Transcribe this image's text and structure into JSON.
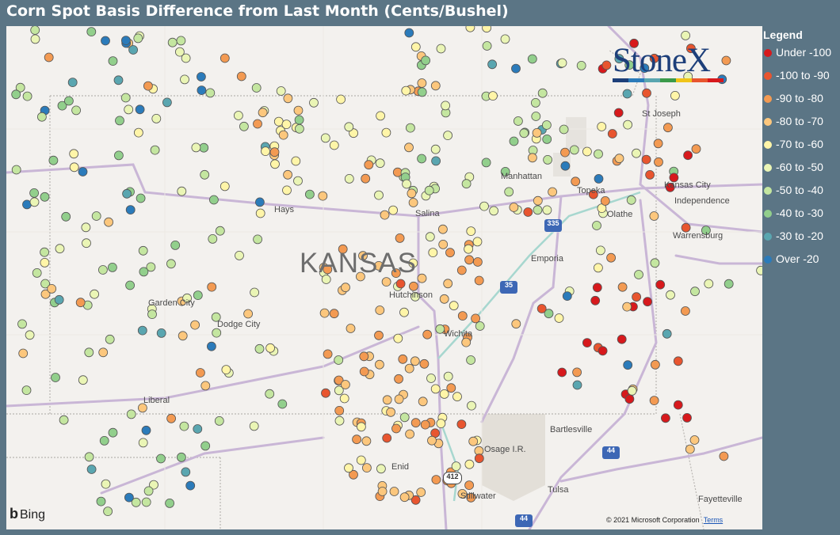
{
  "title": "Corn Spot Basis Difference from Last Month (Cents/Bushel)",
  "legend": {
    "header": "Legend",
    "items": [
      {
        "label": "Under -100",
        "color": "#d7191c"
      },
      {
        "label": "-100 to -90",
        "color": "#e8552f"
      },
      {
        "label": "-90 to -80",
        "color": "#f39a52"
      },
      {
        "label": "-80 to -70",
        "color": "#fcc77d"
      },
      {
        "label": "-70 to -60",
        "color": "#fff5a8"
      },
      {
        "label": "-60 to -50",
        "color": "#eaf5b5"
      },
      {
        "label": "-50 to -40",
        "color": "#c4e6a0"
      },
      {
        "label": "-40 to -30",
        "color": "#92cf8c"
      },
      {
        "label": "-30 to -20",
        "color": "#5aa6b0"
      },
      {
        "label": "Over -20",
        "color": "#2b7bba"
      }
    ]
  },
  "map": {
    "state_label": "KANSAS",
    "cities": [
      "St Joseph",
      "Manhattan",
      "Topeka",
      "Kansas City",
      "Independence",
      "Olathe",
      "Hays",
      "Salina",
      "Warrensburg",
      "Emporia",
      "Garden City",
      "Hutchinson",
      "Dodge City",
      "Wichita",
      "Liberal",
      "Bartlesville",
      "Osage I.R.",
      "Enid",
      "Tulsa",
      "Stillwater",
      "Fayetteville"
    ],
    "highway_shields": [
      "335",
      "35",
      "44",
      "412",
      "44"
    ],
    "provider": "Bing",
    "copyright": "© 2021 Microsoft Corporation",
    "terms_link": "Terms"
  },
  "logo": {
    "text": "StoneX",
    "bar_colors": [
      "#1d3f7a",
      "#2b7bba",
      "#5aa6b0",
      "#3b9a4a",
      "#f0c419",
      "#e8552f",
      "#d7191c"
    ]
  }
}
